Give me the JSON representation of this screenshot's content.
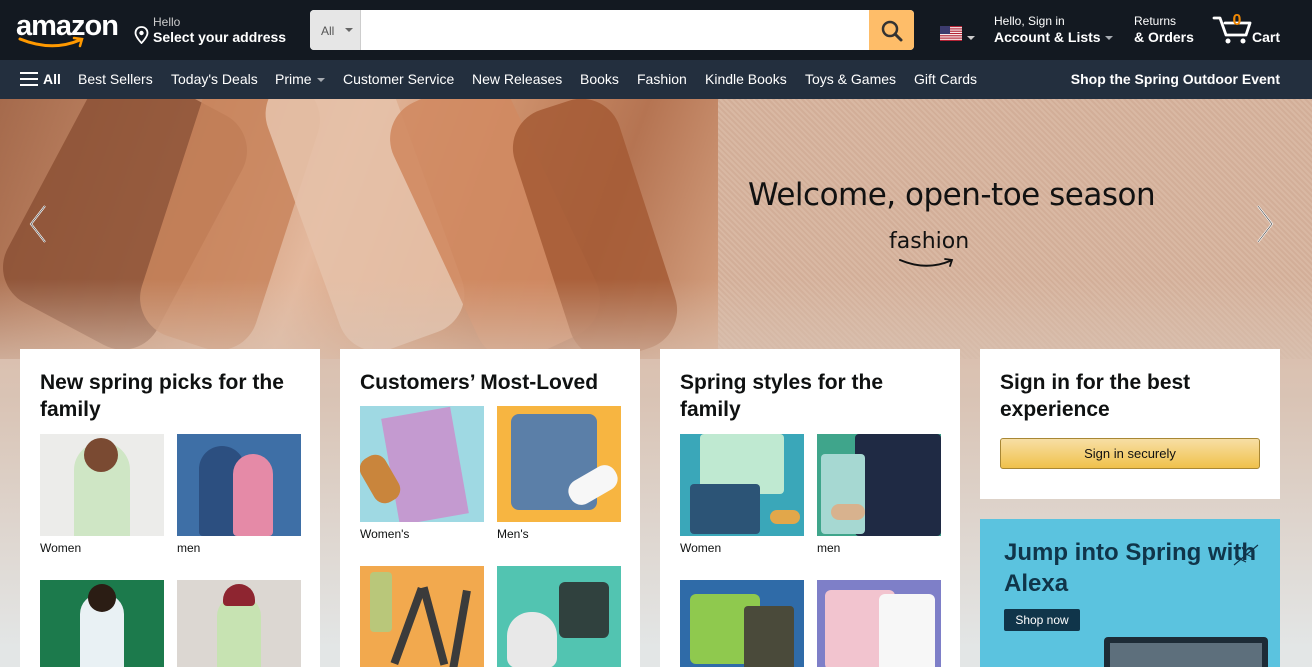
{
  "header": {
    "logo_text": "amazon",
    "address_line1": "Hello",
    "address_line2": "Select your address",
    "search_category": "All",
    "search_placeholder": "",
    "account_line1": "Hello, Sign in",
    "account_line2": "Account & Lists",
    "returns_line1": "Returns",
    "returns_line2": "& Orders",
    "cart_count": "0",
    "cart_label": "Cart"
  },
  "subnav": {
    "all_label": "All",
    "items": [
      "Best Sellers",
      "Today's Deals",
      "Prime",
      "Customer Service",
      "New Releases",
      "Books",
      "Fashion",
      "Kindle Books",
      "Toys & Games",
      "Gift Cards"
    ],
    "promo": "Shop the Spring Outdoor Event"
  },
  "hero": {
    "title": "Welcome, open-toe season",
    "brand": "fashion"
  },
  "cards": [
    {
      "title": "New spring picks for the family",
      "tiles": [
        {
          "label": "Women",
          "color": "#e8e6e2"
        },
        {
          "label": "men",
          "color": "#3e6fa6"
        },
        {
          "label": "",
          "color": "#1c7a4c"
        },
        {
          "label": "",
          "color": "#dcd7d2"
        }
      ]
    },
    {
      "title": "Customers’ Most-Loved",
      "tiles": [
        {
          "label": "Women's",
          "color": "#9fd9e3"
        },
        {
          "label": "Men's",
          "color": "#f7b541"
        },
        {
          "label": "",
          "color": "#f2a94e"
        },
        {
          "label": "",
          "color": "#52c4b1"
        }
      ]
    },
    {
      "title": "Spring styles for the family",
      "tiles": [
        {
          "label": "Women",
          "color": "#3aa7b9"
        },
        {
          "label": "men",
          "color": "#3fa58b"
        },
        {
          "label": "",
          "color": "#2f6ba8"
        },
        {
          "label": "",
          "color": "#7e7fc8"
        }
      ]
    }
  ],
  "signin": {
    "title": "Sign in for the best experience",
    "button": "Sign in securely"
  },
  "alexa_ad": {
    "title": "Jump into Spring with Alexa",
    "cta": "Shop now"
  }
}
